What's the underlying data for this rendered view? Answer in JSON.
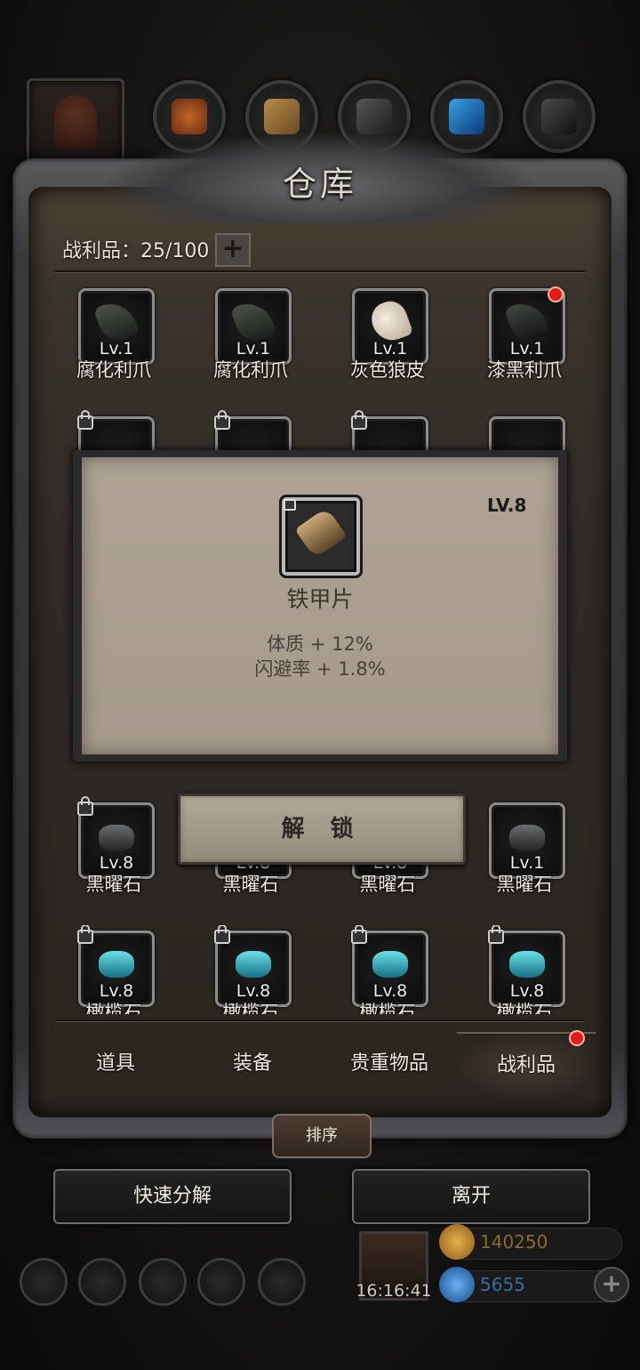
{
  "panel": {
    "title": "仓库"
  },
  "capacity": {
    "label": "战利品：25/100",
    "plus": "+"
  },
  "items_row1": [
    {
      "level": "Lv.1",
      "name": "腐化利爪"
    },
    {
      "level": "Lv.1",
      "name": "腐化利爪"
    },
    {
      "level": "Lv.1",
      "name": "灰色狼皮"
    },
    {
      "level": "Lv.1",
      "name": "漆黑利爪"
    }
  ],
  "items_row3": [
    {
      "level": "Lv.8",
      "name": "黑曜石"
    },
    {
      "level": "Lv.8",
      "name": "黑曜石"
    },
    {
      "level": "Lv.8",
      "name": "黑曜石"
    },
    {
      "level": "Lv.1",
      "name": "黑曜石"
    }
  ],
  "items_row4": [
    {
      "level": "Lv.8",
      "name": "橄榄石"
    },
    {
      "level": "Lv.8",
      "name": "橄榄石"
    },
    {
      "level": "Lv.8",
      "name": "橄榄石"
    },
    {
      "level": "Lv.8",
      "name": "橄榄石"
    }
  ],
  "tooltip": {
    "level": "LV.8",
    "name": "铁甲片",
    "stats": [
      "体质 + 12%",
      "闪避率 + 1.8%"
    ]
  },
  "unlock_button": "解 锁",
  "tabs": [
    "道具",
    "装备",
    "贵重物品",
    "战利品"
  ],
  "active_tab": "战利品",
  "sort_button": "排序",
  "quick_decompose_button": "快速分解",
  "leave_button": "离开",
  "gift": {
    "timer": "16:16:41"
  },
  "resources": {
    "gold": "140250",
    "gems": "5655"
  },
  "colors": {
    "notification": "#e01c1c",
    "parchment": "#ada293",
    "obsidian": "#4a4a4a",
    "olivine": "#2fa0a8"
  }
}
